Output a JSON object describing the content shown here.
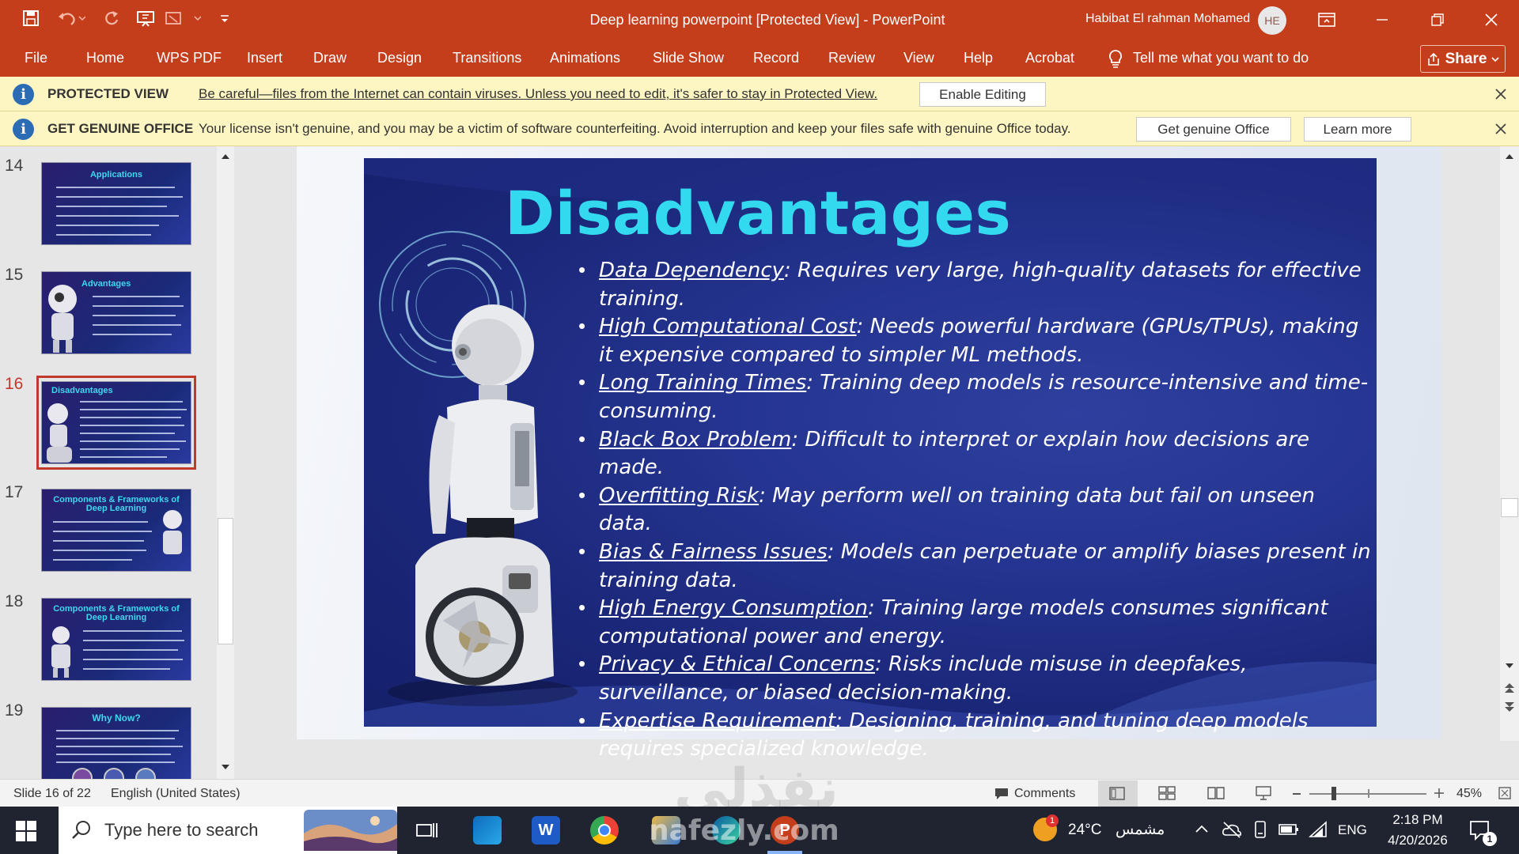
{
  "window": {
    "title": "Deep learning powerpoint [Protected View]  -  PowerPoint",
    "user_name": "Habibat El rahman Mohamed",
    "user_initials": "HE"
  },
  "ribbon": {
    "tabs": [
      "File",
      "Home",
      "WPS PDF",
      "Insert",
      "Draw",
      "Design",
      "Transitions",
      "Animations",
      "Slide Show",
      "Record",
      "Review",
      "View",
      "Help",
      "Acrobat"
    ],
    "tell_me": "Tell me what you want to do",
    "share": "Share"
  },
  "protected_view": {
    "heading": "PROTECTED VIEW",
    "message": "Be careful—files from the Internet can contain viruses. Unless you need to edit, it's safer to stay in Protected View.",
    "button": "Enable Editing"
  },
  "genuine_office": {
    "heading": "GET GENUINE OFFICE",
    "message": "Your license isn't genuine, and you may be a victim of software counterfeiting. Avoid interruption and keep your files safe with genuine Office today.",
    "button_primary": "Get genuine Office",
    "button_secondary": "Learn more"
  },
  "thumbnails": [
    {
      "number": "14",
      "title": "Applications"
    },
    {
      "number": "15",
      "title": "Advantages"
    },
    {
      "number": "16",
      "title": "Disadvantages",
      "selected": true
    },
    {
      "number": "17",
      "title": "Components & Frameworks of Deep Learning"
    },
    {
      "number": "18",
      "title": "Components & Frameworks of Deep Learning"
    },
    {
      "number": "19",
      "title": "Why Now?"
    }
  ],
  "slide": {
    "title": "Disadvantages",
    "bullets": [
      {
        "term": "Data Dependency",
        "text": ": Requires very large, high-quality datasets for effective training."
      },
      {
        "term": "High Computational Cost",
        "text": ": Needs powerful hardware (GPUs/TPUs), making it expensive compared to simpler ML methods."
      },
      {
        "term": "Long Training Times",
        "text": ": Training deep models is resource-intensive and time-consuming."
      },
      {
        "term": "Black Box Problem",
        "text": ": Difficult to interpret or explain how decisions are made."
      },
      {
        "term": "Overfitting Risk",
        "text": ": May perform well on training data but fail on unseen data."
      },
      {
        "term": "Bias & Fairness Issues",
        "text": ": Models can perpetuate or amplify biases present in training data."
      },
      {
        "term": "High Energy Consumption",
        "text": ": Training large models consumes significant computational power and energy."
      },
      {
        "term": "Privacy & Ethical Concerns",
        "text": ": Risks include misuse in deepfakes, surveillance, or biased decision-making."
      },
      {
        "term": "Expertise Requirement",
        "text": ": Designing, training, and tuning deep models requires specialized knowledge."
      }
    ]
  },
  "status": {
    "slide_counter": "Slide 16 of 22",
    "language": "English (United States)",
    "comments": "Comments",
    "zoom": "45%"
  },
  "taskbar": {
    "search_placeholder": "Type here to search",
    "weather": "24°C",
    "weather_text": "مشمس",
    "weather_badge": "1",
    "language": "ENG",
    "time": "2:18 PM",
    "date": "4/20/2026",
    "notification_count": "1"
  },
  "watermark": {
    "arabic": "نفذلي",
    "latin": "nafezly.com"
  },
  "colors": {
    "accent": "#c43e1c",
    "slide_title": "#33d9ee",
    "message_bar": "#fdf6c3",
    "selection": "#c0392b"
  }
}
